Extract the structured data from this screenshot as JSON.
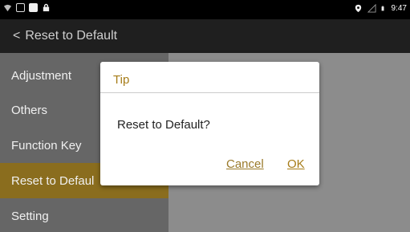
{
  "status_bar": {
    "time": "9:47",
    "left_icons": [
      "wifi-icon",
      "image-icon",
      "square-icon",
      "lock-icon"
    ],
    "right_icons": [
      "location-icon",
      "signal-icon",
      "battery-icon"
    ]
  },
  "action_bar": {
    "title": "Reset to Default"
  },
  "sidebar": {
    "items": [
      {
        "label": "Adjustment"
      },
      {
        "label": "Others"
      },
      {
        "label": "Function Key"
      },
      {
        "label": "Reset to Defaul"
      },
      {
        "label": "Setting"
      }
    ],
    "active_index": 3
  },
  "dialog": {
    "title": "Tip",
    "message": "Reset to Default?",
    "cancel_label": "Cancel",
    "ok_label": "OK"
  },
  "colors": {
    "accent": "#a67c18",
    "active_item": "#8a6d1e",
    "action_bar": "#1f1f1f",
    "sidebar": "#666666"
  }
}
